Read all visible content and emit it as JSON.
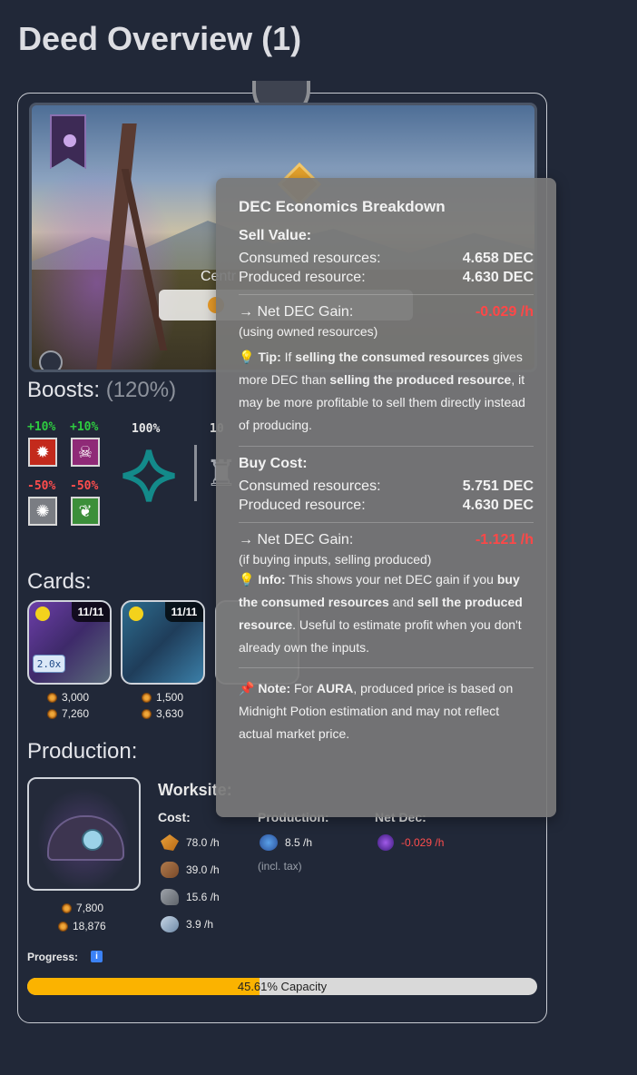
{
  "page": {
    "title": "Deed Overview (1)"
  },
  "deed": {
    "label": "Centr"
  },
  "boosts": {
    "title": "Boosts:",
    "total": "(120%)",
    "items": [
      {
        "pct": "+10%",
        "icon": "fire-icon"
      },
      {
        "pct": "+10%",
        "icon": "death-icon"
      },
      {
        "pct": "-50%",
        "icon": "neutral-icon"
      },
      {
        "pct": "-50%",
        "icon": "earth-icon"
      }
    ],
    "big_pct": "100%",
    "big_pct2": "10"
  },
  "cards": {
    "title": "Cards:",
    "items": [
      {
        "level": "11/11",
        "multiplier": "2.0x",
        "stat1": "3,000",
        "stat2": "7,260"
      },
      {
        "level": "11/11",
        "stat1": "1,500",
        "stat2": "3,630"
      }
    ]
  },
  "production": {
    "title": "Production:",
    "worksite_title": "Worksite: ",
    "worksite_stat1": "7,800",
    "worksite_stat2": "18,876",
    "cost_label": "Cost:",
    "production_label": "Production:",
    "net_label": "Net Dec:",
    "costs": [
      {
        "icon": "grain-icon",
        "value": "78.0 /h"
      },
      {
        "icon": "wood-icon",
        "value": "39.0 /h"
      },
      {
        "icon": "stone-icon",
        "value": "15.6 /h"
      },
      {
        "icon": "iron-icon",
        "value": "3.9 /h"
      }
    ],
    "produced": "8.5 /h",
    "incl_tax": "(incl. tax)",
    "net": "-0.029 /h",
    "progress_label": "Progress:",
    "progress_value": 45.61,
    "progress_text": "45.61% Capacity"
  },
  "tooltip": {
    "title": "DEC Economics Breakdown",
    "sell_title": "Sell Value:",
    "consumed_label": "Consumed resources:",
    "consumed_sell": "4.658 DEC",
    "produced_label": "Produced resource:",
    "produced_sell": "4.630 DEC",
    "net_label": "→ Net DEC Gain:",
    "net_sell": "-0.029 /h",
    "net_sell_note": "(using owned resources)",
    "tip_icon": "💡",
    "tip_label": "Tip:",
    "tip_t1": " If ",
    "tip_b1": "selling the consumed resources",
    "tip_t2": " gives more DEC than ",
    "tip_b2": "selling the produced resource",
    "tip_t3": ", it may be more profitable to sell them directly instead of producing.",
    "buy_title": "Buy Cost:",
    "consumed_buy": "5.751 DEC",
    "produced_buy": "4.630 DEC",
    "net_buy": "-1.121 /h",
    "net_buy_note": "(if buying inputs, selling produced)",
    "info_icon": "💡",
    "info_label": "Info:",
    "info_t1": " This shows your net DEC gain if you ",
    "info_b1": "buy the consumed resources",
    "info_t2": " and ",
    "info_b2": "sell the produced resource",
    "info_t3": ". Useful to estimate profit when you don't already own the inputs.",
    "note_icon": "📌",
    "note_label": "Note:",
    "note_t1": " For ",
    "note_b1": "AURA",
    "note_t2": ", produced price is based on Midnight Potion estimation and may not reflect actual market price."
  }
}
